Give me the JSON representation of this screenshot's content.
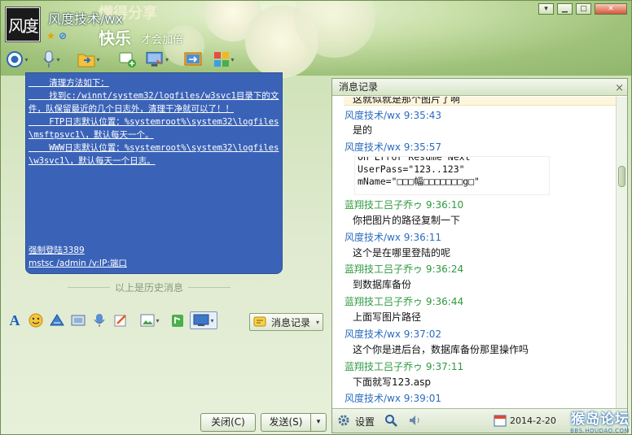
{
  "window": {
    "title": "风度技术/wx",
    "avatar_text": "风度",
    "slogan_top": "懂得分享",
    "slogan_main": "快乐",
    "slogan_sub": "才会加倍",
    "controls": [
      "▾",
      "▁",
      "□",
      "✕"
    ]
  },
  "toolbar": {
    "icons": [
      "video-icon",
      "voice-icon",
      "transfer-file-icon",
      "new-chat-icon",
      "remote-desktop-icon",
      "share-screen-icon",
      "apps-icon"
    ]
  },
  "chat_area": {
    "lines": [
      "    清理方法如下：",
      "    找到c:/winnt/system32/logfiles/w3svc1目录下的文",
      "件，队保留最近的几个日志外，清理干净就可以了！！",
      "    FTP日志默认位置：%systemroot%\\system32\\logfiles",
      "\\msftpsvc1\\，默认每天一个。",
      "    WWW日志默认位置：%systemroot%\\system32\\logfiles",
      "\\w3svc1\\，默认每天一个日志。"
    ],
    "bottom_lines": [
      "强制登陆3389",
      "mstsc /admin /v:IP:端口"
    ],
    "history_divider": "以上是历史消息"
  },
  "format_bar": {
    "icons": [
      "font-icon",
      "emoji-icon",
      "shake-icon",
      "screenshot-icon",
      "voice-message-icon",
      "scrawl-icon",
      "image-icon",
      "gift-icon",
      "screen-share-icon"
    ],
    "record_button": "消息记录"
  },
  "buttons": {
    "close": "关闭(C)",
    "send": "发送(S)"
  },
  "history_panel": {
    "title": "消息记录",
    "close": "×",
    "top_partial": "这就似就是那个图片了啊",
    "entries": [
      {
        "sender": "风度技术/wx",
        "time": "9:35:43",
        "text": "是的",
        "color": "#2a6cc0"
      },
      {
        "sender": "风度技术/wx",
        "time": "9:35:57",
        "text": "",
        "color": "#2a6cc0"
      },
      {
        "sender": "蓝翔技工吕子乔ゥ",
        "time": "9:36:10",
        "text": "你把图片的路径复制一下",
        "color": "#2e9a3f"
      },
      {
        "sender": "风度技术/wx",
        "time": "9:36:11",
        "text": "这个是在哪里登陆的呢",
        "color": "#2a6cc0"
      },
      {
        "sender": "蓝翔技工吕子乔ゥ",
        "time": "9:36:24",
        "text": "到数据库备份",
        "color": "#2e9a3f"
      },
      {
        "sender": "蓝翔技工吕子乔ゥ",
        "time": "9:36:44",
        "text": "上面写图片路径",
        "color": "#2e9a3f"
      },
      {
        "sender": "风度技术/wx",
        "time": "9:37:02",
        "text": "这个你是进后台，数据库备份那里操作吗",
        "color": "#2a6cc0"
      },
      {
        "sender": "蓝翔技工吕子乔ゥ",
        "time": "9:37:11",
        "text": "下面就写123.asp",
        "color": "#2e9a3f"
      },
      {
        "sender": "风度技术/wx",
        "time": "9:39:01",
        "text": "",
        "color": "#2a6cc0"
      }
    ],
    "code_lines": [
      "On Error Resume Next",
      "UserPass=\"123..123\"",
      "mName=\"□□□幅□□□□□□□g□\""
    ],
    "footer": {
      "settings": "设置",
      "date": "2014-2-20"
    }
  },
  "watermark": {
    "main": "猴岛论坛",
    "url": "BBS.HOUDAO.COM"
  }
}
